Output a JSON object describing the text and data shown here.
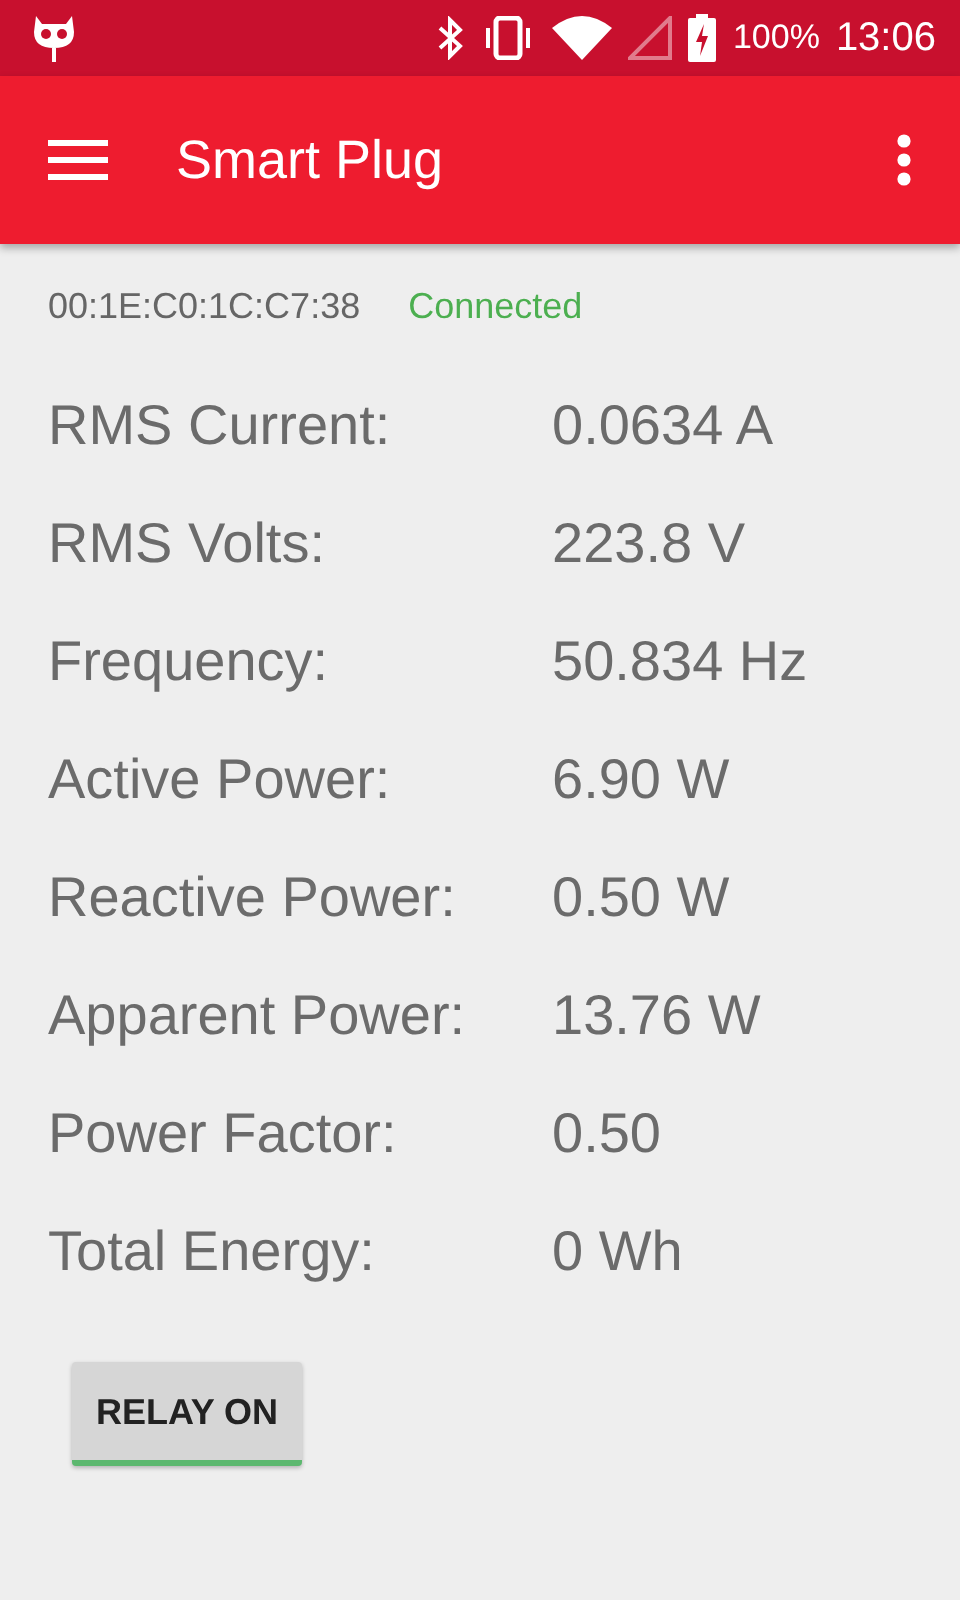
{
  "status_bar": {
    "battery": "100%",
    "time": "13:06"
  },
  "app_bar": {
    "title": "Smart Plug"
  },
  "device": {
    "address": "00:1E:C0:1C:C7:38",
    "status": "Connected",
    "connected": true
  },
  "readings": [
    {
      "label": "RMS Current:",
      "value": "0.0634 A"
    },
    {
      "label": "RMS Volts:",
      "value": "223.8 V"
    },
    {
      "label": "Frequency:",
      "value": "50.834 Hz"
    },
    {
      "label": "Active Power:",
      "value": "6.90 W"
    },
    {
      "label": "Reactive Power:",
      "value": "0.50 W"
    },
    {
      "label": "Apparent Power:",
      "value": "13.76 W"
    },
    {
      "label": "Power Factor:",
      "value": "0.50"
    },
    {
      "label": "Total Energy:",
      "value": "0 Wh"
    }
  ],
  "relay_button": {
    "label": "RELAY ON",
    "on": true
  }
}
